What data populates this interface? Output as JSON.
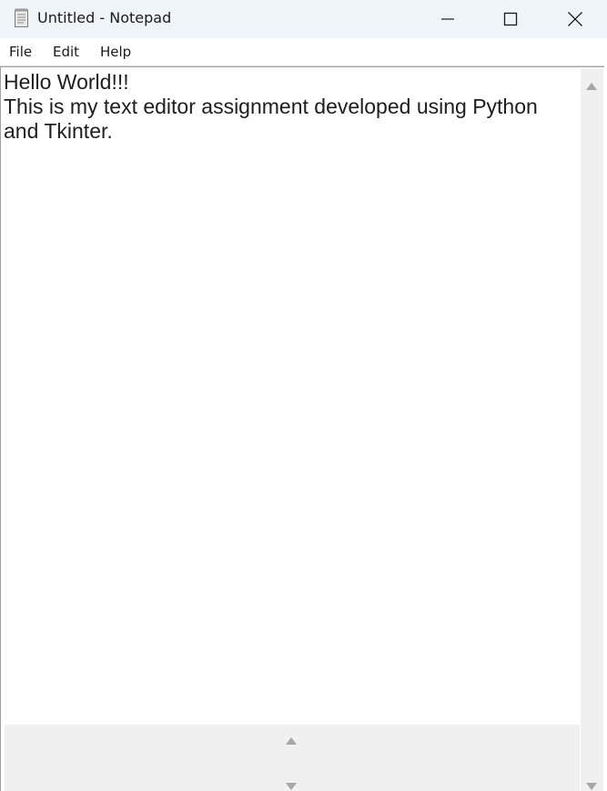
{
  "window": {
    "title": "Untitled - Notepad",
    "app_icon": "notepad-icon",
    "controls": [
      "minimize-icon",
      "maximize-icon",
      "close-icon"
    ]
  },
  "menu": {
    "file": "File",
    "edit": "Edit",
    "help": "Help"
  },
  "editor": {
    "content": "Hello World!!!\nThis is my text editor assignment developed using Python\nand Tkinter."
  },
  "colors": {
    "titlebar_bg": "#eff4f9",
    "scrollbar_bg": "#f0f0f0",
    "text": "#1e1e1e"
  }
}
